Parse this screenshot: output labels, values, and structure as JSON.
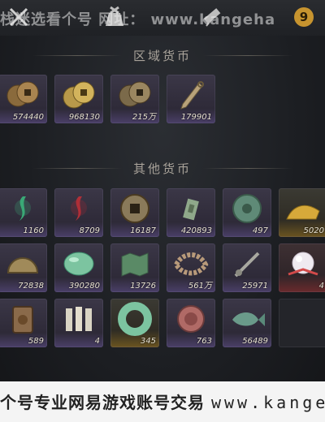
{
  "topbar": {
    "watermark": "栈迷选看个号 网址： www.kangeha",
    "badge": "9",
    "icons": [
      "crossed-swords-icon",
      "scroll-bag-icon",
      "telescope-icon"
    ]
  },
  "sections": {
    "regional": {
      "title": "区域货币"
    },
    "other": {
      "title": "其他货币"
    }
  },
  "regional_items": [
    {
      "icon": "copper-coins-icon",
      "count": "574440",
      "tone": "purple"
    },
    {
      "icon": "gold-coins-icon",
      "count": "968130",
      "tone": "purple"
    },
    {
      "icon": "bronze-coins-icon",
      "count": "215万",
      "tone": "purple"
    },
    {
      "icon": "knife-coin-icon",
      "count": "179901",
      "tone": "purple"
    }
  ],
  "other_items": [
    {
      "icon": "green-spirit-icon",
      "count": "1160",
      "tone": "purple"
    },
    {
      "icon": "red-spirit-icon",
      "count": "8709",
      "tone": "purple"
    },
    {
      "icon": "square-hole-coin-icon",
      "count": "16187",
      "tone": "purple"
    },
    {
      "icon": "jade-tag-icon",
      "count": "420893",
      "tone": "purple"
    },
    {
      "icon": "jade-disc-icon",
      "count": "497",
      "tone": "purple"
    },
    {
      "icon": "gold-pile-icon",
      "count": "5020",
      "tone": "gold"
    },
    {
      "icon": "half-coin-icon",
      "count": "72838",
      "tone": "purple"
    },
    {
      "icon": "jade-stone-icon",
      "count": "390280",
      "tone": "purple"
    },
    {
      "icon": "green-map-icon",
      "count": "13726",
      "tone": "purple"
    },
    {
      "icon": "bead-string-icon",
      "count": "561万",
      "tone": "purple"
    },
    {
      "icon": "coin-sword-icon",
      "count": "25971",
      "tone": "purple"
    },
    {
      "icon": "pearl-icon",
      "count": "4",
      "tone": "red"
    },
    {
      "icon": "bronze-plaque-icon",
      "count": "589",
      "tone": "purple"
    },
    {
      "icon": "bone-tablets-icon",
      "count": "4",
      "tone": "purple"
    },
    {
      "icon": "jade-ring-icon",
      "count": "345",
      "tone": "gold"
    },
    {
      "icon": "red-medallion-icon",
      "count": "763",
      "tone": "purple"
    },
    {
      "icon": "jade-fish-icon",
      "count": "56489",
      "tone": "purple"
    },
    {
      "icon": "",
      "count": "",
      "tone": "empty"
    }
  ],
  "footer": {
    "text": "个号专业网易游戏账号交易 ",
    "url": "www.kangehao.c"
  }
}
